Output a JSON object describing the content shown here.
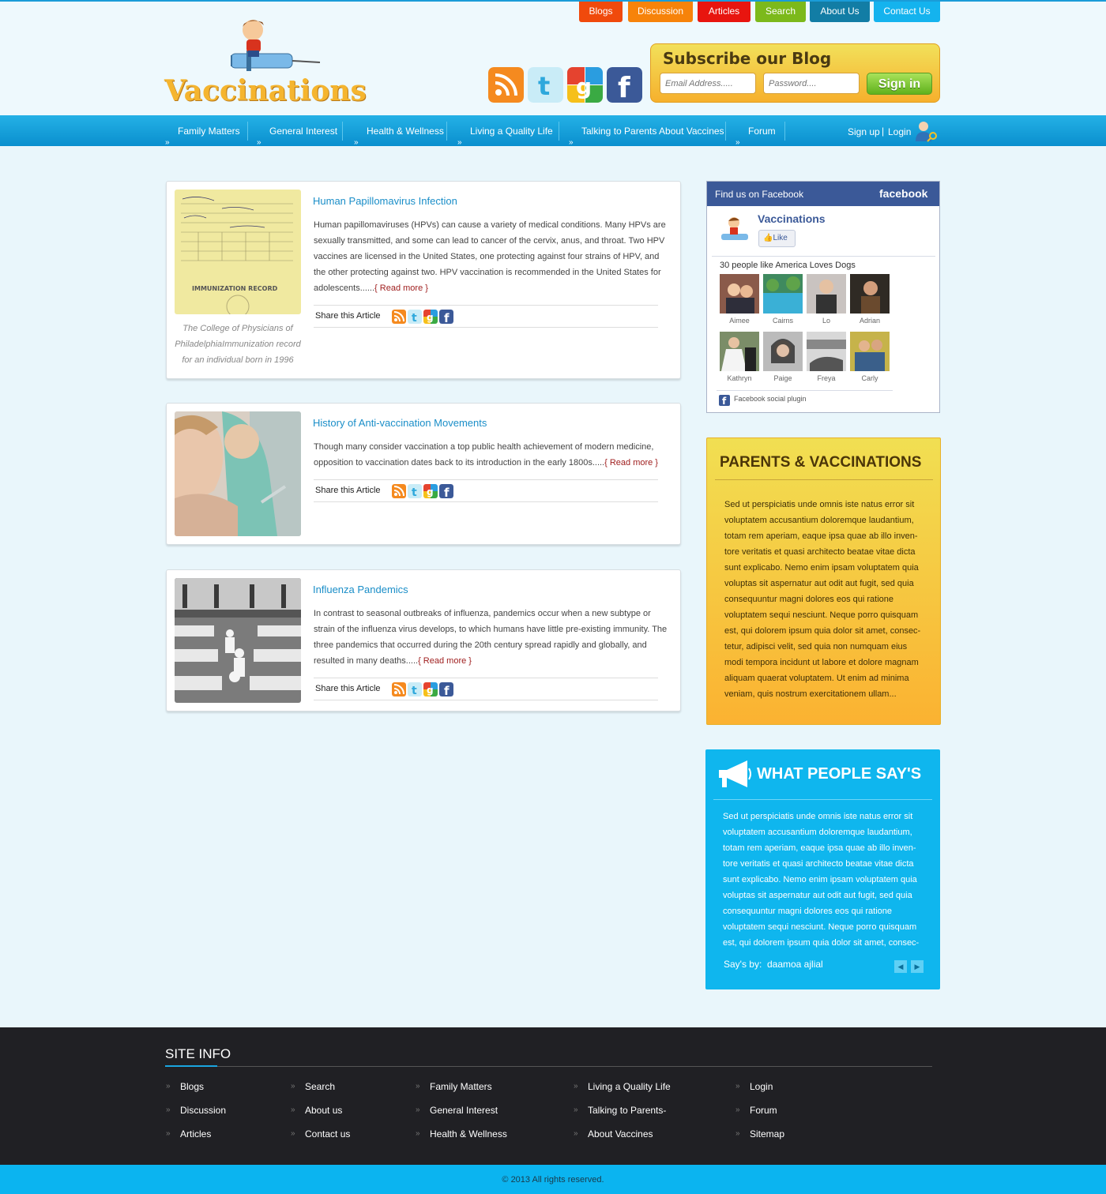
{
  "top_nav": [
    {
      "label": "Blogs",
      "color": "#f04a0c"
    },
    {
      "label": "Discussion",
      "color": "#f7830a"
    },
    {
      "label": "Articles",
      "color": "#e8150f"
    },
    {
      "label": "Search",
      "color": "#7cb91b"
    },
    {
      "label": "About Us",
      "color": "#127da5"
    },
    {
      "label": "Contact Us",
      "color": "#14b3ee"
    }
  ],
  "logo": {
    "text": "Vaccinations"
  },
  "social_icons": [
    "rss-icon",
    "twitter-icon",
    "google-icon",
    "facebook-icon"
  ],
  "subscribe": {
    "title": "Subscribe our Blog",
    "email_placeholder": "Email Address.....",
    "password_placeholder": "Password....",
    "signin_label": "Sign in"
  },
  "main_nav": {
    "items": [
      "Family Matters",
      "General Interest",
      "Health & Wellness",
      "Living a Quality Life",
      "Talking to Parents About Vaccines",
      "Forum"
    ],
    "signup": "Sign up",
    "separator": "|",
    "login": "Login"
  },
  "articles": [
    {
      "title": "Human Papillomavirus Infection",
      "text": "Human papillomaviruses (HPVs) can cause a variety of medical conditions. Many HPVs are sexually transmitted, and some can lead to cancer of the cervix, anus, and throat. Two HPV vaccines are licensed in the United States, one protecting against four strains of HPV, and the other protecting against two. HPV vaccination is recommended in the United States for adolescents......",
      "read_more": "{ Read more }",
      "caption": "The College of Physicians of PhiladelphiaImmunization record for an individual born in 1996",
      "share_label": "Share this Article"
    },
    {
      "title": "History of Anti-vaccination Movements",
      "text": "Though many consider vaccination a top public health achievement of modern medicine, opposition to vaccination dates back to its introduction in the early 1800s.....",
      "read_more": "{ Read more }",
      "share_label": "Share this Article"
    },
    {
      "title": "Influenza Pandemics",
      "text": "In contrast to seasonal outbreaks of influenza, pandemics occur when a new subtype or strain of the influenza virus develops, to which humans have little pre-existing immunity. The three pandemics that occurred during the 20th century spread rapidly and globally, and resulted in many deaths.....",
      "read_more": "{ Read more }",
      "share_label": "Share this Article"
    }
  ],
  "facebook": {
    "header": "Find us on Facebook",
    "brand": "facebook",
    "page_name": "Vaccinations",
    "like_label": "Like",
    "likes_text": "30 people like",
    "likes_page": "America Loves Dogs",
    "people": [
      "Aimee",
      "Cairns",
      "Lo",
      "Adrian",
      "Kathryn",
      "Paige",
      "Freya",
      "Carly"
    ],
    "plugin_text": "Facebook social plugin"
  },
  "parents": {
    "title": "PARENTS & VACCINATIONS",
    "text": "Sed ut perspiciatis unde omnis iste natus error sit voluptatem accusantium doloremque laudantium, totam rem aperiam, eaque ipsa quae ab illo inven-tore veritatis et quasi architecto beatae vitae dicta sunt explicabo. Nemo enim ipsam voluptatem quia voluptas sit aspernatur aut odit aut fugit, sed quia consequuntur magni dolores eos qui ratione voluptatem sequi nesciunt. Neque porro quisquam est, qui dolorem ipsum quia dolor sit amet, consec-tetur, adipisci velit, sed quia non numquam eius modi tempora incidunt ut labore et dolore magnam aliquam quaerat voluptatem. Ut enim ad minima veniam, quis nostrum exercitationem ullam..."
  },
  "people_say": {
    "title": "WHAT PEOPLE SAY'S",
    "text": "Sed ut perspiciatis unde omnis iste natus error sit voluptatem accusantium doloremque laudantium, totam rem aperiam, eaque ipsa quae ab illo inven-tore veritatis et quasi architecto beatae vitae dicta sunt explicabo. Nemo enim ipsam voluptatem quia voluptas sit aspernatur aut odit aut fugit, sed quia consequuntur magni dolores eos qui ratione voluptatem sequi nesciunt. Neque porro quisquam est, qui dolorem ipsum quia dolor sit amet, consec-",
    "says_by": "Say's by:",
    "author": "daamoa ajlial"
  },
  "footer": {
    "title": "SITE INFO",
    "columns": [
      [
        "Blogs",
        "Discussion",
        "Articles"
      ],
      [
        "Search",
        "About us",
        "Contact us"
      ],
      [
        "Family Matters",
        "General Interest",
        "Health & Wellness"
      ],
      [
        "Living a Quality Life",
        "Talking to Parents-",
        "About Vaccines"
      ],
      [
        "Login",
        "Forum",
        "Sitemap"
      ]
    ],
    "copyright": "© 2013 All rights reserved."
  }
}
